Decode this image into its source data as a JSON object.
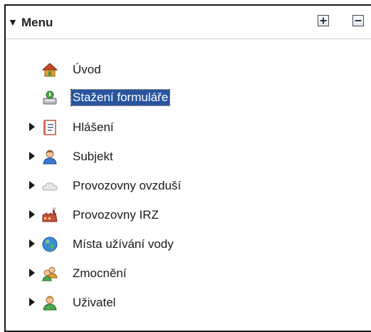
{
  "menu": {
    "title": "Menu",
    "toggle_glyph": "▼",
    "expand_all_icon": "plus-box-icon",
    "collapse_all_icon": "minus-box-icon",
    "items": [
      {
        "label": "Úvod",
        "icon": "home-icon",
        "expandable": false,
        "selected": false
      },
      {
        "label": "Stažení formuláře",
        "icon": "download-form-icon",
        "expandable": false,
        "selected": true
      },
      {
        "label": "Hlášení",
        "icon": "report-icon",
        "expandable": true,
        "selected": false
      },
      {
        "label": "Subjekt",
        "icon": "subject-person-icon",
        "expandable": true,
        "selected": false
      },
      {
        "label": "Provozovny ovzduší",
        "icon": "cloud-icon",
        "expandable": true,
        "selected": false
      },
      {
        "label": "Provozovny IRZ",
        "icon": "factory-icon",
        "expandable": true,
        "selected": false
      },
      {
        "label": "Místa užívání vody",
        "icon": "globe-icon",
        "expandable": true,
        "selected": false
      },
      {
        "label": "Zmocnění",
        "icon": "users-icon",
        "expandable": true,
        "selected": false
      },
      {
        "label": "Uživatel",
        "icon": "user-icon",
        "expandable": true,
        "selected": false
      }
    ]
  },
  "colors": {
    "selection_bg": "#27559e",
    "selection_text": "#ffffff",
    "panel_border": "#1a1a1a"
  }
}
